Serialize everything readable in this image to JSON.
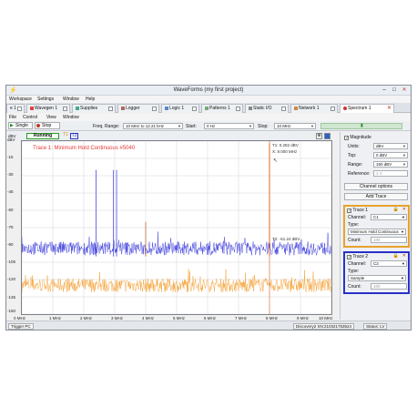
{
  "window": {
    "title": "WaveForms  (my first project)",
    "controls": [
      "–",
      "□",
      "✕"
    ]
  },
  "menu": {
    "items": [
      "Workspace",
      "Settings",
      "Window",
      "Help"
    ]
  },
  "tabs": [
    {
      "label": "e 1",
      "active": false
    },
    {
      "label": "Wavegen 1",
      "active": false
    },
    {
      "label": "Supplies",
      "active": false
    },
    {
      "label": "Logger",
      "active": false
    },
    {
      "label": "Logic 1",
      "active": false
    },
    {
      "label": "Patterns 1",
      "active": false
    },
    {
      "label": "Static I/O",
      "active": false
    },
    {
      "label": "Network 1",
      "active": false
    },
    {
      "label": "Spectrum 1",
      "active": true
    }
  ],
  "submenu": {
    "items": [
      "File",
      "Control",
      "View",
      "Window"
    ]
  },
  "toolbar": {
    "single_label": "Single",
    "stop_label": "Stop",
    "freq_range_label": "Freq. Range:",
    "freq_range_value": "10 MHz to 12.21 kHz",
    "start_label": "Start:",
    "start_value": "0 Hz",
    "stop_freq_label": "Stop:",
    "stop_freq_value": "10 MHz"
  },
  "plotbar": {
    "unit": "dBV",
    "running_label": "Running",
    "t1_label": "T1",
    "t2_label": "T2"
  },
  "plot": {
    "trace_title": "Trace 1: Minimum Hold Continuous #5040",
    "cursor_t1": "T1: 0.282 dBV",
    "cursor_x": "X: 8.000 MHz",
    "cursor_t2": "T2: -61.24 dBV",
    "y_ticks": [
      "dBV",
      "-15",
      "-30",
      "-45",
      "-60",
      "-75",
      "-90",
      "-105",
      "-120",
      "-135",
      "-150"
    ],
    "x_ticks": [
      "0 MHz",
      "1 MHz",
      "2 MHz",
      "3 MHz",
      "4 MHz",
      "5 MHz",
      "6 MHz",
      "7 MHz",
      "8 MHz",
      "9 MHz",
      "10 MHz"
    ],
    "colors": {
      "trace1": "#f5a742",
      "trace2": "#4a4ae0",
      "cursor": "#e06020",
      "grid": "#c8ccd2"
    }
  },
  "chart_data": {
    "type": "line",
    "xlabel": "",
    "ylabel": "dBV",
    "xlim": [
      0,
      10
    ],
    "ylim": [
      -150,
      0
    ],
    "x_unit": "MHz",
    "series": [
      {
        "name": "Trace 1",
        "baseline": -125,
        "spread": 6
      },
      {
        "name": "Trace 2",
        "baseline": -93,
        "spread": 6
      }
    ],
    "spurs_mhz": [
      2.4,
      2.96,
      3.06,
      4.0,
      8.0
    ],
    "spur_levels_dbv": [
      -25,
      -25,
      -25,
      -70,
      -2
    ]
  },
  "panel": {
    "magnitude_label": "Magnitude",
    "units_label": "Units:",
    "units_value": "dBV",
    "top_label": "Top:",
    "top_value": "0 dBV",
    "range_label": "Range:",
    "range_value": "150 dBV",
    "reference_label": "Reference:",
    "reference_value": "1 V",
    "channel_options_label": "Channel options",
    "add_trace_label": "Add Trace",
    "traces": [
      {
        "title": "Trace 1",
        "channel_label": "Channel:",
        "channel_value": "C1",
        "type_label": "Type:",
        "type_value": "Minimum Hold Continuous",
        "count_label": "Count:",
        "count_value": "100"
      },
      {
        "title": "Trace 2",
        "channel_label": "Channel:",
        "channel_value": "C2",
        "type_label": "Type:",
        "type_value": "Sample",
        "count_label": "Count:",
        "count_value": "100"
      }
    ]
  },
  "status": {
    "trigger_label": "Trigger PC",
    "device": "Discovery2 SN:210321753524",
    "status_label": "Status: LV"
  }
}
